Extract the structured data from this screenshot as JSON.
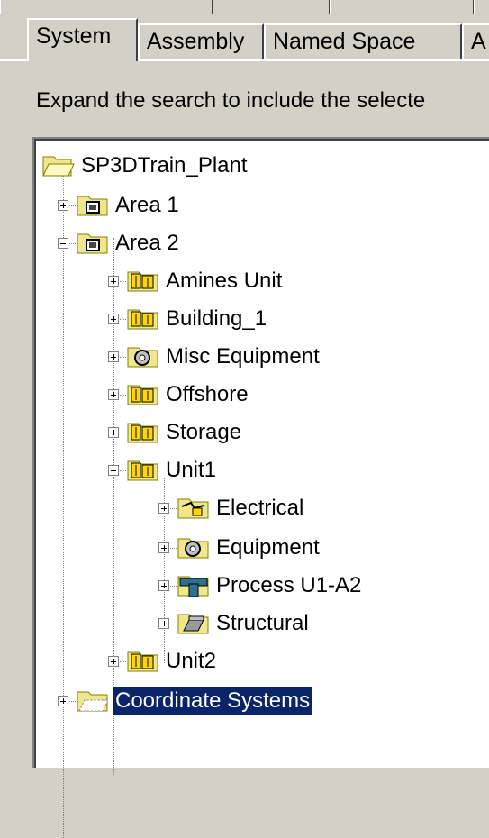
{
  "tabs": [
    {
      "label": "System",
      "selected": true
    },
    {
      "label": "Assembly",
      "selected": false
    },
    {
      "label": "Named Space",
      "selected": false
    },
    {
      "label": "A",
      "selected": false
    }
  ],
  "description": "Expand the search to include the selecte",
  "tree": {
    "root": "SP3DTrain_Plant",
    "items": [
      {
        "label": "Area 1",
        "icon": "area-icon",
        "expanded": false
      },
      {
        "label": "Area 2",
        "icon": "area-icon",
        "expanded": true
      },
      {
        "label": "Amines Unit",
        "icon": "unit-icon",
        "expanded": false
      },
      {
        "label": "Building_1",
        "icon": "unit-icon",
        "expanded": false
      },
      {
        "label": "Misc Equipment",
        "icon": "equipment-icon",
        "expanded": false
      },
      {
        "label": "Offshore",
        "icon": "unit-icon",
        "expanded": false
      },
      {
        "label": "Storage",
        "icon": "unit-icon",
        "expanded": false
      },
      {
        "label": "Unit1",
        "icon": "unit-icon",
        "expanded": true
      },
      {
        "label": "Electrical",
        "icon": "electrical-icon",
        "expanded": false
      },
      {
        "label": "Equipment",
        "icon": "equipment-icon",
        "expanded": false
      },
      {
        "label": "Process U1-A2",
        "icon": "piping-icon",
        "expanded": false
      },
      {
        "label": "Structural",
        "icon": "structural-icon",
        "expanded": false
      },
      {
        "label": "Unit2",
        "icon": "unit-icon",
        "expanded": false
      },
      {
        "label": "Coordinate Systems",
        "icon": "coordinate-system-icon",
        "expanded": false,
        "selected": true
      }
    ]
  },
  "colors": {
    "selection": "#0a246a",
    "folder": "#f0e68c",
    "window": "#d4d0c8"
  }
}
